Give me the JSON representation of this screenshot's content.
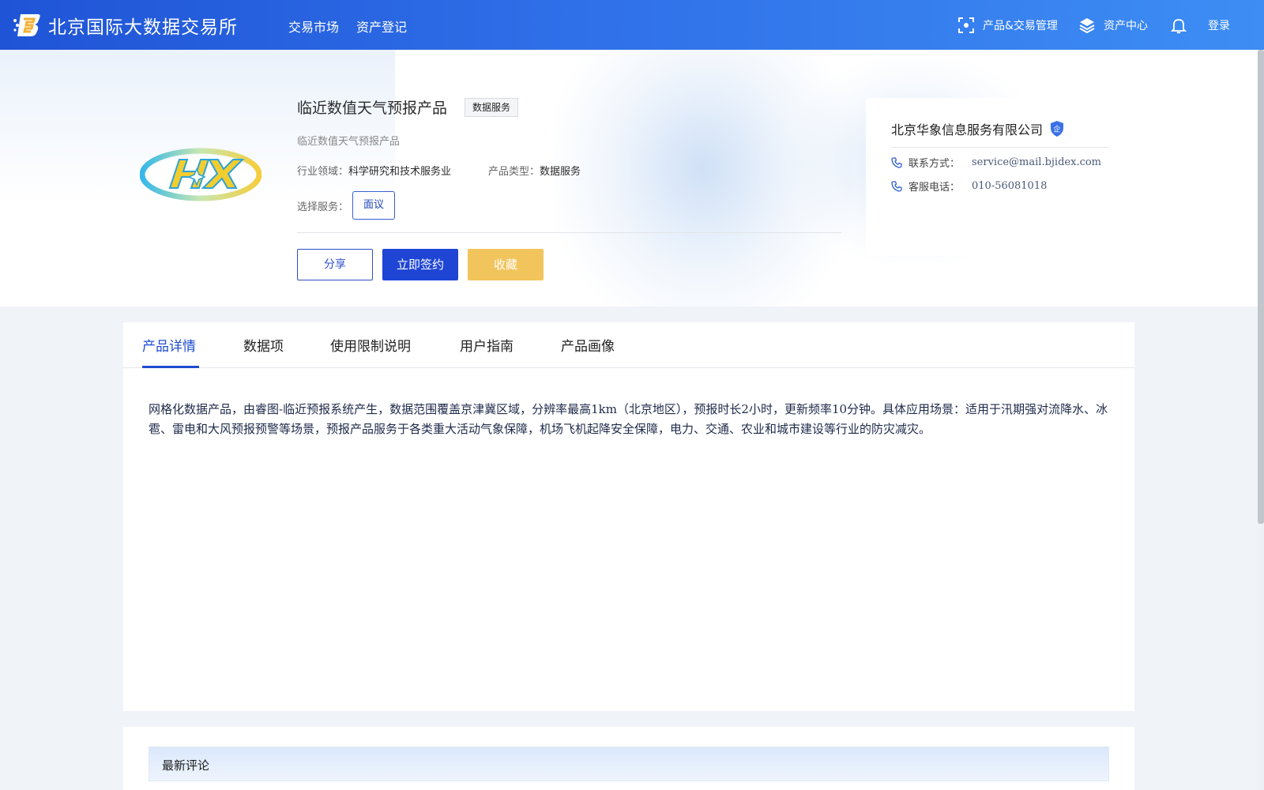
{
  "header": {
    "brand_title": "北京国际大数据交易所",
    "nav": [
      "交易市场",
      "资产登记"
    ],
    "right": {
      "product_trade": "产品&交易管理",
      "asset_center": "资产中心",
      "login": "登录"
    }
  },
  "product": {
    "title": "临近数值天气预报产品",
    "tag": "数据服务",
    "subtitle": "临近数值天气预报产品",
    "industry_label": "行业领域：",
    "industry_value": "科学研究和技术服务业",
    "type_label": "产品类型：",
    "type_value": "数据服务",
    "service_label": "选择服务：",
    "service_option": "面议",
    "actions": {
      "share": "分享",
      "sign": "立即签约",
      "favorite": "收藏"
    }
  },
  "company": {
    "name": "北京华象信息服务有限公司",
    "badge": "企",
    "contact_label": "联系方式：",
    "contact_value": "service@mail.bjidex.com",
    "phone_label": "客服电话：",
    "phone_value": "010-56081018"
  },
  "tabs": [
    "产品详情",
    "数据项",
    "使用限制说明",
    "用户指南",
    "产品画像"
  ],
  "active_tab": 0,
  "description": "网格化数据产品，由睿图-临近预报系统产生，数据范围覆盖京津冀区域，分辨率最高1km（北京地区），预报时长2小时，更新频率10分钟。具体应用场景：适用于汛期强对流降水、冰雹、雷电和大风预报预警等场景，预报产品服务于各类重大活动气象保障，机场飞机起降安全保障，电力、交通、农业和城市建设等行业的防灾减灾。",
  "comments": {
    "title": "最新评论"
  },
  "colors": {
    "primary": "#1e45d4",
    "favorite": "#f2c45c",
    "header_start": "#1f54d6",
    "header_end": "#3d8df4"
  }
}
